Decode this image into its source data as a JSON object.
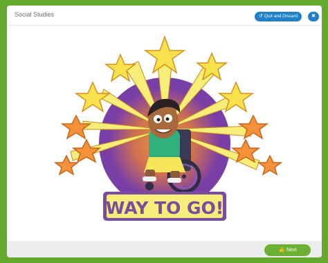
{
  "header": {
    "title": "Social Studies",
    "quit_label": "Quit and Discard"
  },
  "main": {
    "banner_text": "WAY TO GO!"
  },
  "footer": {
    "next_label": "Next"
  },
  "colors": {
    "frame_green": "#64a92d",
    "accent_blue": "#1f7fc8",
    "next_green": "#6cb134",
    "banner_purple": "#7a4ba0",
    "banner_yellow": "#f5ee7a"
  },
  "icons": [
    "undo-icon",
    "expand-icon",
    "thumbs-up-icon"
  ]
}
